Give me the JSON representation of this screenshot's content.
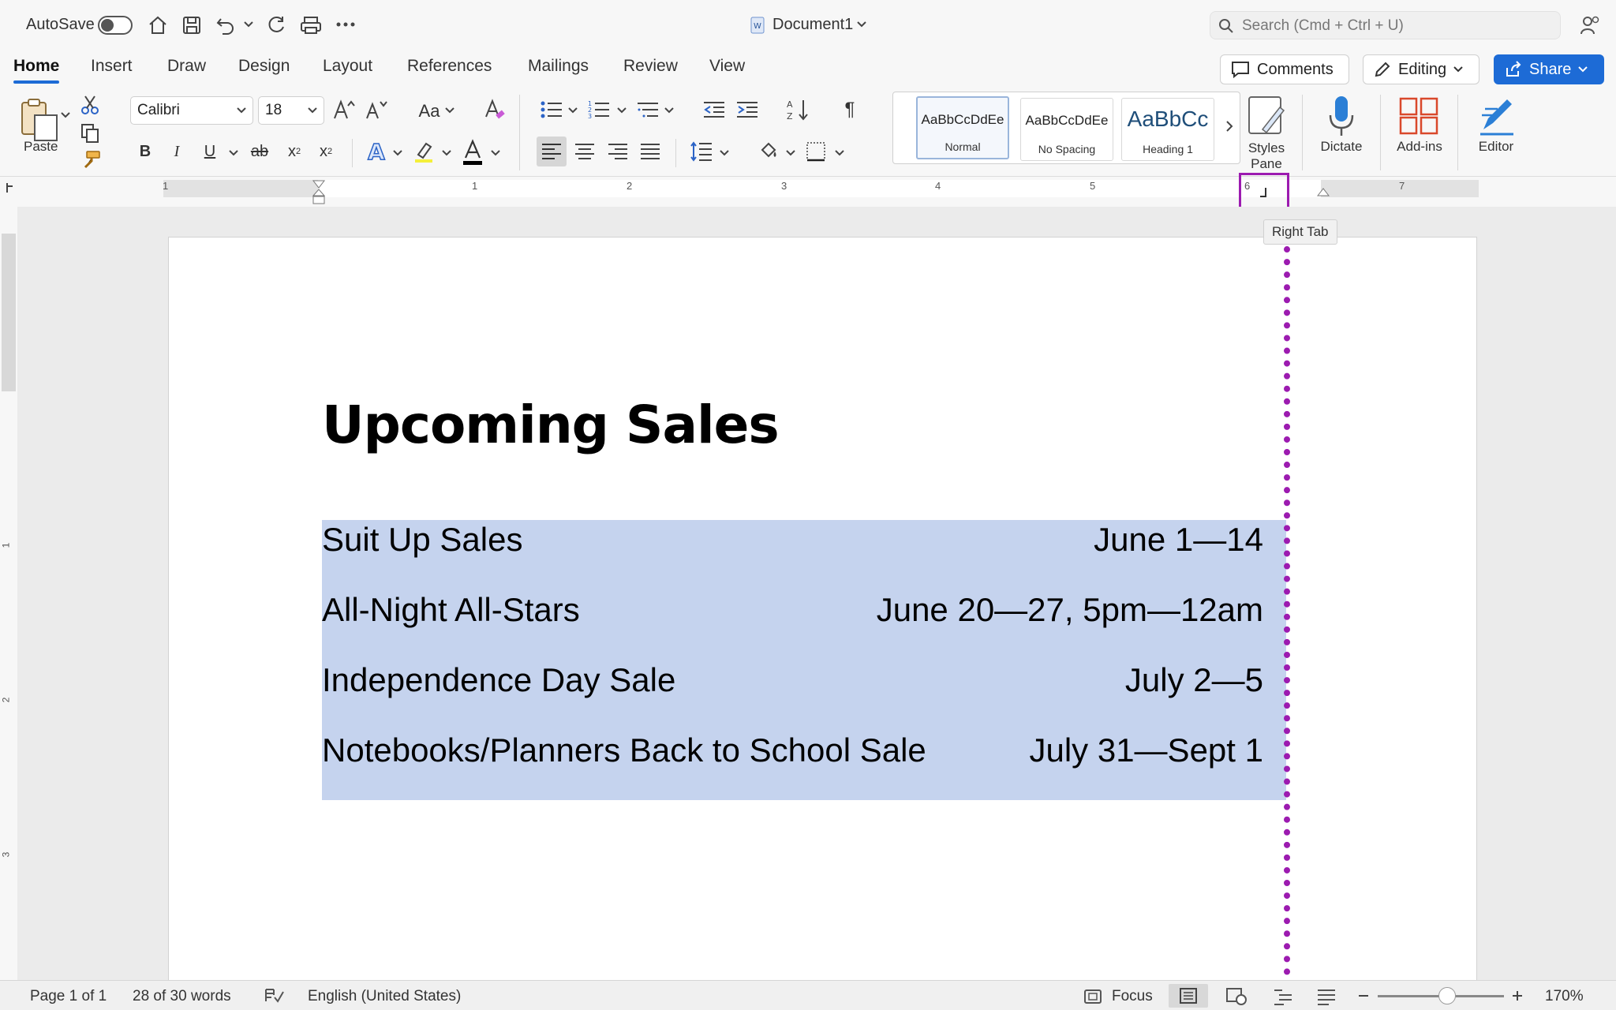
{
  "titlebar": {
    "autosave_label": "AutoSave",
    "document_name": "Document1",
    "search_placeholder": "Search (Cmd + Ctrl + U)"
  },
  "tabs": [
    "Home",
    "Insert",
    "Draw",
    "Design",
    "Layout",
    "References",
    "Mailings",
    "Review",
    "View"
  ],
  "actions": {
    "comments": "Comments",
    "editing": "Editing",
    "share": "Share"
  },
  "ribbon": {
    "paste": "Paste",
    "font_name": "Calibri",
    "font_size": "18",
    "styles": [
      {
        "sample": "AaBbCcDdEe",
        "name": "Normal"
      },
      {
        "sample": "AaBbCcDdEe",
        "name": "No Spacing"
      },
      {
        "sample": "AaBbCc",
        "name": "Heading 1"
      }
    ],
    "styles_pane": "Styles Pane",
    "dictate": "Dictate",
    "addins": "Add-ins",
    "editor": "Editor"
  },
  "ruler": {
    "numbers": [
      "1",
      "1",
      "2",
      "3",
      "4",
      "5",
      "6",
      "7"
    ],
    "tooltip": "Right Tab"
  },
  "document": {
    "title": "Upcoming Sales",
    "lines": [
      {
        "left": "Suit Up Sales",
        "right": "June 1—14"
      },
      {
        "left": "All-Night All-Stars",
        "right": "June 20—27, 5pm—12am"
      },
      {
        "left": "Independence Day Sale",
        "right": "July 2—5"
      },
      {
        "left": "Notebooks/Planners Back to School Sale",
        "right": "July 31—Sept 1"
      }
    ]
  },
  "status": {
    "page": "Page 1 of 1",
    "words": "28 of 30 words",
    "language": "English (United States)",
    "focus": "Focus",
    "zoom": "170%"
  },
  "colors": {
    "accent": "#1d6bd6",
    "selection": "#c5d3ee",
    "tab_guide": "#9c1bb0"
  }
}
